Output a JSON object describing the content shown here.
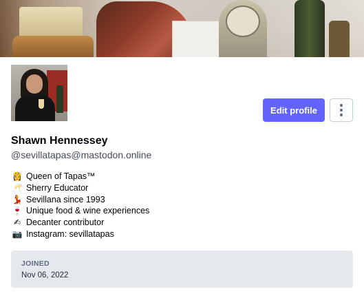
{
  "profile": {
    "display_name": "Shawn Hennessey",
    "handle": "@sevillatapas@mastodon.online",
    "edit_label": "Edit profile"
  },
  "bio": [
    {
      "icon": "woman-crown-icon",
      "glyph": "👸",
      "text": "Queen of Tapas™"
    },
    {
      "icon": "clinking-glasses-icon",
      "glyph": "🥂",
      "text": "Sherry Educator"
    },
    {
      "icon": "dancer-icon",
      "glyph": "💃",
      "text": "Sevillana since 1993"
    },
    {
      "icon": "wine-glass-icon",
      "glyph": "🍷",
      "text": "Unique food & wine experiences"
    },
    {
      "icon": "writing-hand-icon",
      "glyph": "✍",
      "text": "Decanter contributor"
    },
    {
      "icon": "camera-icon",
      "glyph": "📷",
      "text": "Instagram: sevillatapas"
    }
  ],
  "joined": {
    "label": "JOINED",
    "date": "Nov 06, 2022"
  },
  "colors": {
    "accent": "#6364ff",
    "joined_bg": "#e5e9ee"
  }
}
